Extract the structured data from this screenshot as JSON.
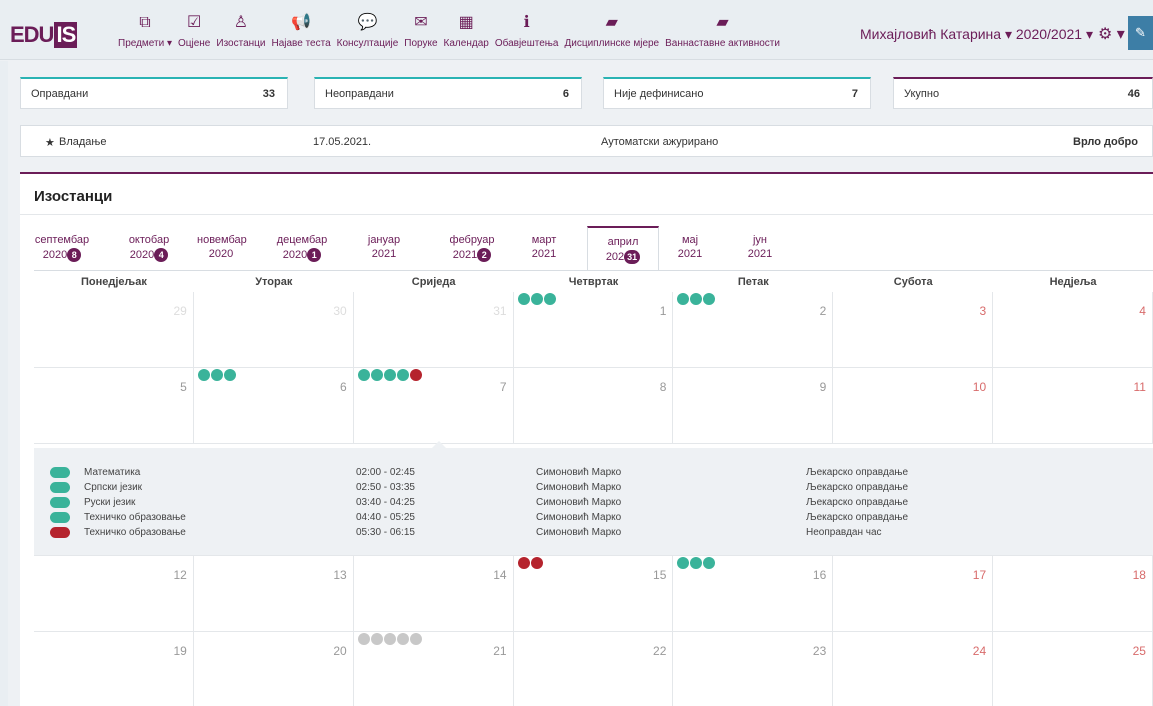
{
  "header": {
    "logo_text": "EDU",
    "logo_box": "IS",
    "nav": [
      {
        "label": "Предмети ▾",
        "icon": "book-stack-icon",
        "glyph": "⧉"
      },
      {
        "label": "Оцјене",
        "icon": "checkbox-icon",
        "glyph": "☑"
      },
      {
        "label": "Изостанци",
        "icon": "user-icon",
        "glyph": "♙"
      },
      {
        "label": "Најаве теста",
        "icon": "megaphone-icon",
        "glyph": "📢"
      },
      {
        "label": "Консултације",
        "icon": "chat-icon",
        "glyph": "💬"
      },
      {
        "label": "Поруке",
        "icon": "envelope-icon",
        "glyph": "✉"
      },
      {
        "label": "Календар",
        "icon": "calendar-icon",
        "glyph": "▦"
      },
      {
        "label": "Обавјештења",
        "icon": "info-icon",
        "glyph": "ℹ"
      },
      {
        "label": "Дисциплинске мјере",
        "icon": "book-icon",
        "glyph": "▰"
      },
      {
        "label": "Ваннаставне активности",
        "icon": "book-icon",
        "glyph": "▰"
      }
    ],
    "user": "Михајловић Катарина ▾ 2020/2021 ▾",
    "gear_glyph": "⚙ ▾",
    "pen_glyph": "✎"
  },
  "summary": [
    {
      "label": "Оправдани",
      "value": "33"
    },
    {
      "label": "Неоправдани",
      "value": "6"
    },
    {
      "label": "Није дефинисано",
      "value": "7"
    },
    {
      "label": "Укупно",
      "value": "46"
    }
  ],
  "behavior": {
    "star": "★",
    "label": "Владање",
    "date": "17.05.2021.",
    "note": "Аутоматски ажурирано",
    "grade": "Врло добро"
  },
  "panel": {
    "title": "Изостанци",
    "months": [
      {
        "m": "септембар",
        "y": "2020",
        "badge": "8"
      },
      {
        "m": "октобар",
        "y": "2020",
        "badge": "4"
      },
      {
        "m": "новембар",
        "y": "2020",
        "badge": ""
      },
      {
        "m": "децембар",
        "y": "2020",
        "badge": "1"
      },
      {
        "m": "јануар",
        "y": "2021",
        "badge": ""
      },
      {
        "m": "фебруар",
        "y": "2021",
        "badge": "2"
      },
      {
        "m": "март",
        "y": "2021",
        "badge": ""
      },
      {
        "m": "април",
        "y": "202",
        "badge": "31"
      },
      {
        "m": "мај",
        "y": "2021",
        "badge": ""
      },
      {
        "m": "јун",
        "y": "2021",
        "badge": ""
      }
    ],
    "weekdays": [
      "Понедјељак",
      "Уторак",
      "Сриједа",
      "Четвртак",
      "Петак",
      "Субота",
      "Недјеља"
    ],
    "weeks": [
      [
        {
          "n": "29",
          "o": true
        },
        {
          "n": "30",
          "o": true
        },
        {
          "n": "31",
          "o": true
        },
        {
          "n": "1",
          "d": [
            "g",
            "g",
            "g"
          ]
        },
        {
          "n": "2",
          "d": [
            "g",
            "g",
            "g"
          ]
        },
        {
          "n": "3",
          "w": true
        },
        {
          "n": "4",
          "w": true
        }
      ],
      [
        {
          "n": "5"
        },
        {
          "n": "6",
          "d": [
            "g",
            "g",
            "g"
          ]
        },
        {
          "n": "7",
          "d": [
            "g",
            "g",
            "g",
            "g",
            "r"
          ]
        },
        {
          "n": "8"
        },
        {
          "n": "9"
        },
        {
          "n": "10",
          "w": true
        },
        {
          "n": "11",
          "w": true
        }
      ],
      [
        {
          "n": "12"
        },
        {
          "n": "13"
        },
        {
          "n": "14"
        },
        {
          "n": "15",
          "d": [
            "r",
            "r"
          ]
        },
        {
          "n": "16",
          "d": [
            "g",
            "g",
            "g"
          ]
        },
        {
          "n": "17",
          "w": true
        },
        {
          "n": "18",
          "w": true
        }
      ],
      [
        {
          "n": "19"
        },
        {
          "n": "20"
        },
        {
          "n": "21",
          "d": [
            "x",
            "x",
            "x",
            "x",
            "x"
          ]
        },
        {
          "n": "22"
        },
        {
          "n": "23"
        },
        {
          "n": "24",
          "w": true
        },
        {
          "n": "25",
          "w": true
        }
      ]
    ],
    "details": [
      {
        "subject": "Математика",
        "time": "02:00 - 02:45",
        "teacher": "Симоновић Марко",
        "reason": "Љекарско оправдање",
        "c": "g"
      },
      {
        "subject": "Српски језик",
        "time": "02:50 - 03:35",
        "teacher": "Симоновић Марко",
        "reason": "Љекарско оправдање",
        "c": "g"
      },
      {
        "subject": "Руски језик",
        "time": "03:40 - 04:25",
        "teacher": "Симоновић Марко",
        "reason": "Љекарско оправдање",
        "c": "g"
      },
      {
        "subject": "Техничко образовање",
        "time": "04:40 - 05:25",
        "teacher": "Симоновић Марко",
        "reason": "Љекарско оправдање",
        "c": "g"
      },
      {
        "subject": "Техничко образовање",
        "time": "05:30 - 06:15",
        "teacher": "Симоновић Марко",
        "reason": "Неоправдан час",
        "c": "r"
      }
    ]
  },
  "colors": {
    "g": "#3ab39a",
    "r": "#b5232d",
    "x": "#c8c8c8",
    "brand": "#6b1d58",
    "accent": "#2ab3b3"
  }
}
